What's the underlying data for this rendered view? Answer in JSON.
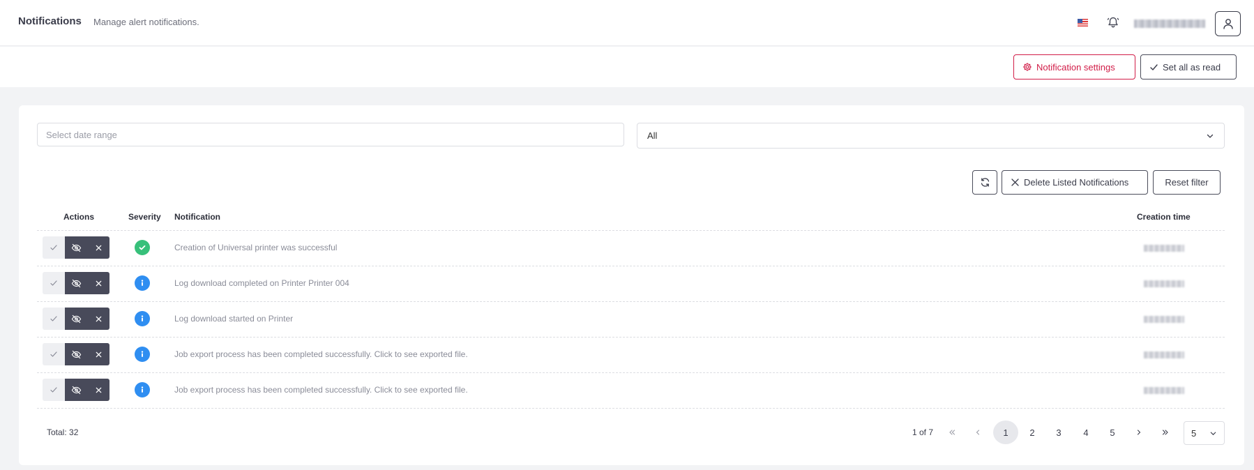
{
  "header": {
    "title": "Notifications",
    "subtitle": "Manage alert notifications.",
    "language_icon": "us-flag-icon",
    "bell_icon": "bell-icon",
    "user_icon": "user-icon"
  },
  "toolbar": {
    "settings_label": "Notification settings",
    "read_all_label": "Set all as read",
    "danger_color": "#d11c47"
  },
  "filters": {
    "date_placeholder": "Select date range",
    "severity_value": "All"
  },
  "table_actions": {
    "delete_label": "Delete Listed Notifications",
    "reset_label": "Reset filter"
  },
  "table": {
    "headers": {
      "actions": "Actions",
      "severity": "Severity",
      "notification": "Notification",
      "creation_time": "Creation time"
    },
    "rows": [
      {
        "severity": "success",
        "text": "Creation of Universal printer was successful"
      },
      {
        "severity": "info",
        "text": "Log download completed on Printer Printer 004"
      },
      {
        "severity": "info",
        "text": "Log download started on Printer"
      },
      {
        "severity": "info",
        "text": "Job export process has been completed successfully. Click to see exported file."
      },
      {
        "severity": "info",
        "text": "Job export process has been completed successfully. Click to see exported file."
      }
    ]
  },
  "pagination": {
    "total": "Total: 32",
    "page_info": "1 of 7",
    "pages": [
      "1",
      "2",
      "3",
      "4",
      "5"
    ],
    "current": "1",
    "page_size": "5"
  }
}
